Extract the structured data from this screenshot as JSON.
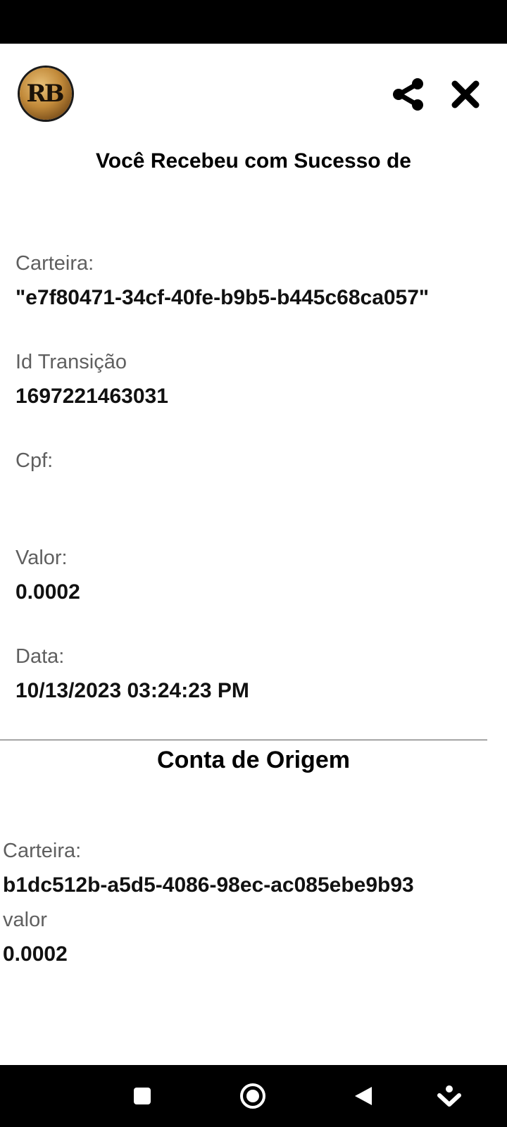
{
  "header": {
    "logo_text": "RB",
    "title": "Você Recebeu com Sucesso de"
  },
  "icons": {
    "share": "share-icon",
    "close": "close-icon",
    "nav_square": "square-icon",
    "nav_home": "circle-icon",
    "nav_back": "back-triangle-icon",
    "nav_extra": "download-arrow-icon"
  },
  "details": {
    "wallet_label": "Carteira:",
    "wallet_value": "\"e7f80471-34cf-40fe-b9b5-b445c68ca057\"",
    "transaction_label": "Id Transição",
    "transaction_value": "1697221463031",
    "cpf_label": "Cpf:",
    "cpf_value": "",
    "amount_label": "Valor:",
    "amount_value": "0.0002",
    "date_label": "Data:",
    "date_value": "10/13/2023 03:24:23 PM"
  },
  "origin": {
    "title": "Conta de Origem",
    "wallet_label": "Carteira:",
    "wallet_value": "b1dc512b-a5d5-4086-98ec-ac085ebe9b93",
    "amount_label": "valor",
    "amount_value": "0.0002"
  },
  "colors": {
    "background": "#ffffff",
    "bars": "#000000",
    "label": "#5f5f5f",
    "value": "#111111"
  }
}
